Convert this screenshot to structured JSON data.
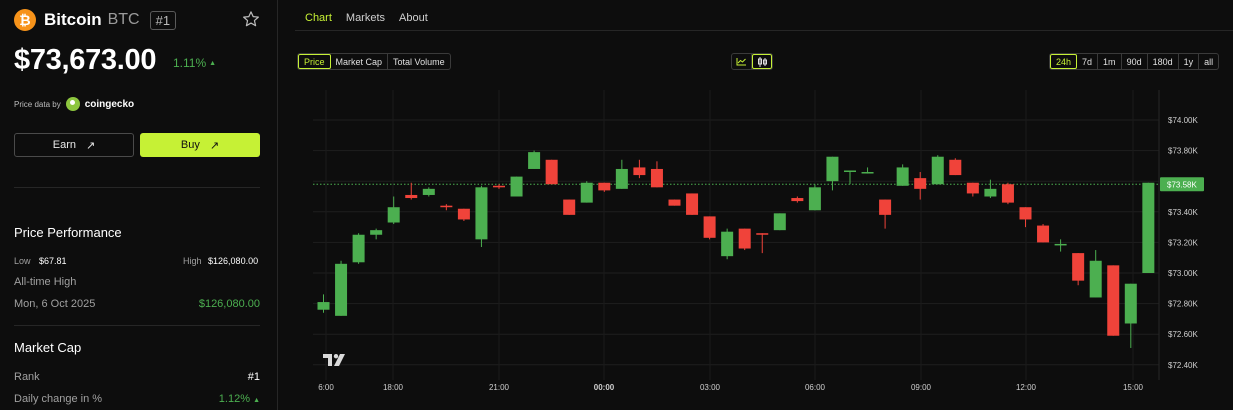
{
  "coin": {
    "name": "Bitcoin",
    "symbol": "BTC",
    "rank_badge": "#1",
    "price": "$73,673.00",
    "change_pct": "1.11%",
    "change_arrow": "▲"
  },
  "price_data": {
    "label": "Price data by",
    "provider": "coingecko"
  },
  "actions": {
    "earn_label": "Earn",
    "buy_label": "Buy",
    "arrow": "↗"
  },
  "price_performance": {
    "title": "Price Performance",
    "low_label": "Low",
    "low_value": "$67.81",
    "high_label": "High",
    "high_value": "$126,080.00",
    "ath_label": "All-time High",
    "ath_date": "Mon, 6 Oct 2025",
    "ath_value": "$126,080.00"
  },
  "market_cap": {
    "title": "Market Cap",
    "rank_label": "Rank",
    "rank_value": "#1",
    "daily_change_label": "Daily change in %",
    "daily_change_value": "1.12%",
    "daily_change_arrow": "▲"
  },
  "tabs": [
    {
      "label": "Chart",
      "active": true
    },
    {
      "label": "Markets",
      "active": false
    },
    {
      "label": "About",
      "active": false
    }
  ],
  "metric_options": [
    "Price",
    "Market Cap",
    "Total Volume"
  ],
  "metric_selected": "Price",
  "range_options": [
    "24h",
    "7d",
    "1m",
    "90d",
    "180d",
    "1y",
    "all"
  ],
  "range_selected": "24h",
  "chart_type_icons": [
    "line-chart-icon",
    "candlestick-icon"
  ],
  "colors": {
    "accent": "#c6f135",
    "up": "#4caf50",
    "down": "#f0433a",
    "bitcoin": "#f7931a"
  },
  "chart_data": {
    "type": "candlestick",
    "y_ticks": [
      "$74.00K",
      "$73.80K",
      "$73.60K",
      "$73.40K",
      "$73.20K",
      "$73.00K",
      "$72.80K",
      "$72.60K",
      "$72.40K"
    ],
    "ylim": [
      72380,
      74140
    ],
    "x_ticks": [
      "6:00",
      "18:00",
      "21:00",
      "00:00",
      "03:00",
      "06:00",
      "09:00",
      "12:00",
      "15:00"
    ],
    "current_price_label": "$73.58K",
    "current_price": 73580,
    "grid": true,
    "candles": [
      {
        "o": 72760,
        "h": 72860,
        "l": 72740,
        "c": 72810
      },
      {
        "o": 72720,
        "h": 73080,
        "l": 72720,
        "c": 73060
      },
      {
        "o": 73070,
        "h": 73260,
        "l": 73060,
        "c": 73250
      },
      {
        "o": 73250,
        "h": 73290,
        "l": 73220,
        "c": 73280
      },
      {
        "o": 73330,
        "h": 73500,
        "l": 73320,
        "c": 73430
      },
      {
        "o": 73510,
        "h": 73590,
        "l": 73480,
        "c": 73490
      },
      {
        "o": 73510,
        "h": 73560,
        "l": 73500,
        "c": 73550
      },
      {
        "o": 73440,
        "h": 73450,
        "l": 73410,
        "c": 73430
      },
      {
        "o": 73420,
        "h": 73420,
        "l": 73340,
        "c": 73350
      },
      {
        "o": 73220,
        "h": 73570,
        "l": 73170,
        "c": 73560
      },
      {
        "o": 73570,
        "h": 73580,
        "l": 73550,
        "c": 73560
      },
      {
        "o": 73500,
        "h": 73630,
        "l": 73500,
        "c": 73630
      },
      {
        "o": 73680,
        "h": 73800,
        "l": 73680,
        "c": 73790
      },
      {
        "o": 73740,
        "h": 73740,
        "l": 73580,
        "c": 73580
      },
      {
        "o": 73480,
        "h": 73480,
        "l": 73380,
        "c": 73380
      },
      {
        "o": 73460,
        "h": 73600,
        "l": 73460,
        "c": 73590
      },
      {
        "o": 73590,
        "h": 73590,
        "l": 73530,
        "c": 73540
      },
      {
        "o": 73550,
        "h": 73740,
        "l": 73550,
        "c": 73680
      },
      {
        "o": 73690,
        "h": 73740,
        "l": 73620,
        "c": 73640
      },
      {
        "o": 73680,
        "h": 73730,
        "l": 73560,
        "c": 73560
      },
      {
        "o": 73480,
        "h": 73480,
        "l": 73440,
        "c": 73440
      },
      {
        "o": 73520,
        "h": 73520,
        "l": 73380,
        "c": 73380
      },
      {
        "o": 73370,
        "h": 73370,
        "l": 73220,
        "c": 73230
      },
      {
        "o": 73110,
        "h": 73290,
        "l": 73090,
        "c": 73270
      },
      {
        "o": 73290,
        "h": 73290,
        "l": 73150,
        "c": 73160
      },
      {
        "o": 73260,
        "h": 73260,
        "l": 73130,
        "c": 73250
      },
      {
        "o": 73280,
        "h": 73390,
        "l": 73280,
        "c": 73390
      },
      {
        "o": 73490,
        "h": 73500,
        "l": 73460,
        "c": 73470
      },
      {
        "o": 73410,
        "h": 73580,
        "l": 73410,
        "c": 73560
      },
      {
        "o": 73600,
        "h": 73760,
        "l": 73540,
        "c": 73760
      },
      {
        "o": 73670,
        "h": 73670,
        "l": 73580,
        "c": 73670
      },
      {
        "o": 73660,
        "h": 73690,
        "l": 73650,
        "c": 73660
      },
      {
        "o": 73480,
        "h": 73480,
        "l": 73290,
        "c": 73380
      },
      {
        "o": 73570,
        "h": 73710,
        "l": 73570,
        "c": 73690
      },
      {
        "o": 73620,
        "h": 73660,
        "l": 73480,
        "c": 73550
      },
      {
        "o": 73580,
        "h": 73770,
        "l": 73580,
        "c": 73760
      },
      {
        "o": 73740,
        "h": 73750,
        "l": 73640,
        "c": 73640
      },
      {
        "o": 73590,
        "h": 73590,
        "l": 73500,
        "c": 73520
      },
      {
        "o": 73500,
        "h": 73610,
        "l": 73490,
        "c": 73550
      },
      {
        "o": 73580,
        "h": 73590,
        "l": 73450,
        "c": 73460
      },
      {
        "o": 73430,
        "h": 73430,
        "l": 73300,
        "c": 73350
      },
      {
        "o": 73310,
        "h": 73320,
        "l": 73200,
        "c": 73200
      },
      {
        "o": 73190,
        "h": 73220,
        "l": 73140,
        "c": 73190
      },
      {
        "o": 73130,
        "h": 73130,
        "l": 72920,
        "c": 72950
      },
      {
        "o": 72840,
        "h": 73150,
        "l": 72840,
        "c": 73080
      },
      {
        "o": 73050,
        "h": 73050,
        "l": 72590,
        "c": 72590
      },
      {
        "o": 72670,
        "h": 72930,
        "l": 72510,
        "c": 72930
      },
      {
        "o": 73000,
        "h": 73590,
        "l": 73000,
        "c": 73590
      }
    ]
  }
}
